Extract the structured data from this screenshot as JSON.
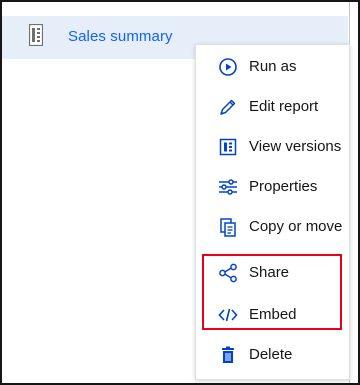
{
  "report": {
    "name": "Sales summary",
    "icon": "report-icon"
  },
  "context_menu": {
    "items": [
      {
        "label": "Run as",
        "icon": "play-circle-icon"
      },
      {
        "label": "Edit report",
        "icon": "pencil-icon"
      },
      {
        "label": "View versions",
        "icon": "versions-icon"
      },
      {
        "label": "Properties",
        "icon": "sliders-icon"
      },
      {
        "label": "Copy or move",
        "icon": "copy-icon"
      },
      {
        "label": "Share",
        "icon": "share-icon"
      },
      {
        "label": "Embed",
        "icon": "code-icon"
      },
      {
        "label": "Delete",
        "icon": "trash-icon"
      }
    ],
    "highlighted_items": [
      "Share",
      "Embed"
    ]
  },
  "colors": {
    "selected_row_bg": "#e5eef9",
    "link_blue": "#0f62fe",
    "icon_blue": "#0043ce",
    "highlight_red": "#e8001c"
  }
}
